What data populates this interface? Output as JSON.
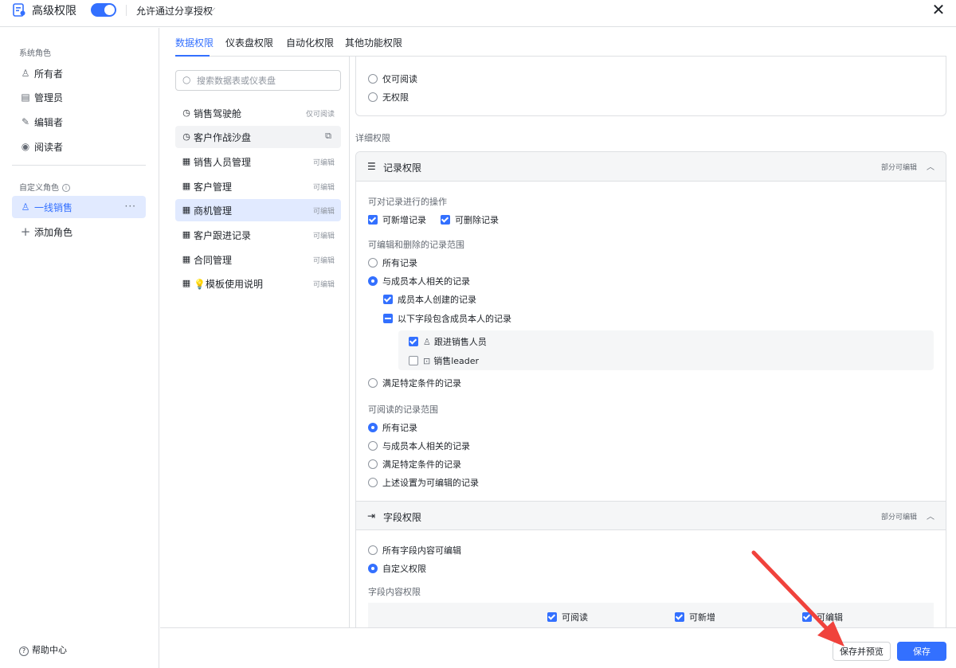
{
  "header": {
    "title": "高级权限",
    "share_label": "允许通过分享授权",
    "accent_color": "#3370ff"
  },
  "sidebar": {
    "system_roles_label": "系统角色",
    "system_roles": [
      {
        "label": "所有者",
        "icon": "owner-icon"
      },
      {
        "label": "管理员",
        "icon": "admin-icon"
      },
      {
        "label": "编辑者",
        "icon": "edit-icon"
      },
      {
        "label": "阅读者",
        "icon": "eye-icon"
      }
    ],
    "custom_roles_label": "自定义角色",
    "custom_roles": [
      {
        "label": "一线销售",
        "selected": true
      }
    ],
    "add_role_label": "添加角色",
    "help_label": "帮助中心"
  },
  "tabs": [
    {
      "label": "数据权限",
      "active": true
    },
    {
      "label": "仪表盘权限",
      "active": false
    },
    {
      "label": "自动化权限",
      "active": false
    },
    {
      "label": "其他功能权限",
      "active": false
    }
  ],
  "search": {
    "placeholder": "搜索数据表或仪表盘"
  },
  "tables": [
    {
      "name": "销售驾驶舱",
      "status": "仅可阅读",
      "icon": "dashboard-icon"
    },
    {
      "name": "客户作战沙盘",
      "status": "",
      "icon": "dashboard-icon"
    },
    {
      "name": "销售人员管理",
      "status": "可编辑",
      "icon": "table-icon"
    },
    {
      "name": "客户管理",
      "status": "可编辑",
      "icon": "table-icon"
    },
    {
      "name": "商机管理",
      "status": "可编辑",
      "icon": "table-icon",
      "selected": true
    },
    {
      "name": "客户跟进记录",
      "status": "可编辑",
      "icon": "table-icon"
    },
    {
      "name": "合同管理",
      "status": "可编辑",
      "icon": "table-icon"
    },
    {
      "name": "💡模板使用说明",
      "status": "可编辑",
      "icon": "table-icon"
    }
  ],
  "table_access": {
    "options": [
      "仅可阅读",
      "无权限"
    ]
  },
  "detail_label": "详细权限",
  "record_perm": {
    "title": "记录权限",
    "status": "部分可编辑",
    "ops_label": "可对记录进行的操作",
    "op_add": "可新增记录",
    "op_delete": "可删除记录",
    "edit_scope_label": "可编辑和删除的记录范围",
    "edit_all": "所有记录",
    "edit_related": "与成员本人相关的记录",
    "created_by_self": "成员本人创建的记录",
    "fields_contain_self": "以下字段包含成员本人的记录",
    "field_sales": "跟进销售人员",
    "field_leader": "销售leader",
    "edit_condition": "满足特定条件的记录",
    "read_scope_label": "可阅读的记录范围",
    "read_all": "所有记录",
    "read_related": "与成员本人相关的记录",
    "read_condition": "满足特定条件的记录",
    "read_editable": "上述设置为可编辑的记录"
  },
  "field_perm": {
    "title": "字段权限",
    "status": "部分可编辑",
    "opt_all_editable": "所有字段内容可编辑",
    "opt_custom": "自定义权限",
    "content_label": "字段内容权限",
    "col_read": "可阅读",
    "col_add": "可新增",
    "col_edit": "可编辑"
  },
  "footer": {
    "preview_label": "保存并预览",
    "save_label": "保存"
  }
}
